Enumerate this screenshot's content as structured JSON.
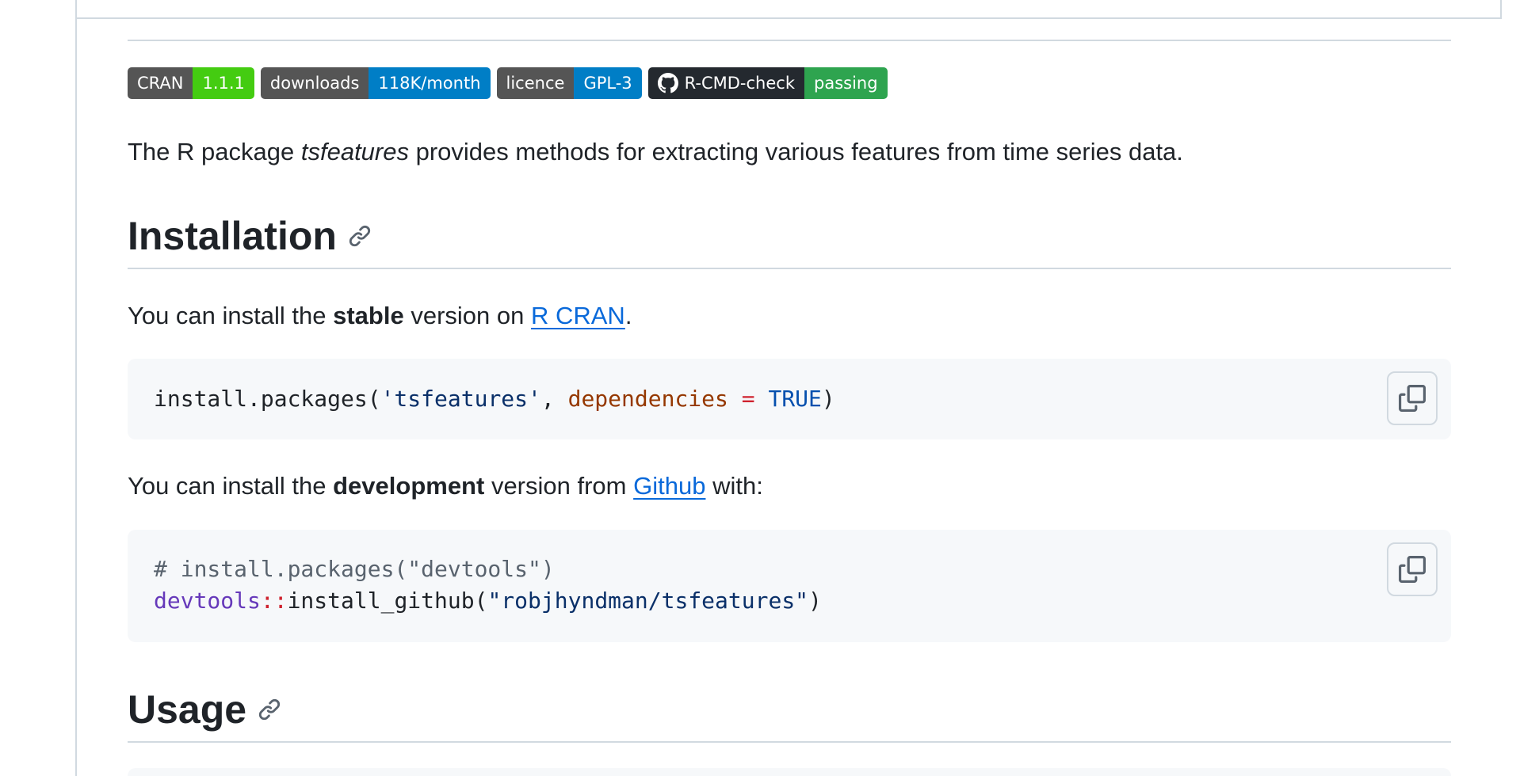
{
  "badges": [
    {
      "label": "CRAN",
      "value": "1.1.1",
      "color": "#4c1"
    },
    {
      "label": "downloads",
      "value": "118K/month",
      "color": "#007ec6"
    },
    {
      "label": "licence",
      "value": "GPL-3",
      "color": "#007ec6"
    },
    {
      "label": "R-CMD-check",
      "value": "passing",
      "color": "#2ea44f",
      "icon": "github-icon"
    }
  ],
  "intro": {
    "before": "The R package ",
    "em": "tsfeatures",
    "after": " provides methods for extracting various features from time series data."
  },
  "installation": {
    "heading": "Installation",
    "stable": {
      "before": "You can install the ",
      "bold": "stable",
      "middle": " version on ",
      "link": "R CRAN",
      "after": "."
    },
    "code1": {
      "fn": "install.packages(",
      "str": "'tsfeatures'",
      "comma": ", ",
      "arg": "dependencies",
      "op": " = ",
      "const": "TRUE",
      "close": ")"
    },
    "dev": {
      "before": "You can install the ",
      "bold": "development",
      "middle": " version from ",
      "link": "Github",
      "after": " with:"
    },
    "code2": {
      "comment": "# install.packages(\"devtools\")",
      "ns": "devtools",
      "nsop": "::",
      "fn": "install_github(",
      "str": "\"robjhyndman/tsfeatures\"",
      "close": ")"
    }
  },
  "usage": {
    "heading": "Usage"
  },
  "icons": {
    "copy": "copy-icon",
    "anchor": "link-icon"
  }
}
